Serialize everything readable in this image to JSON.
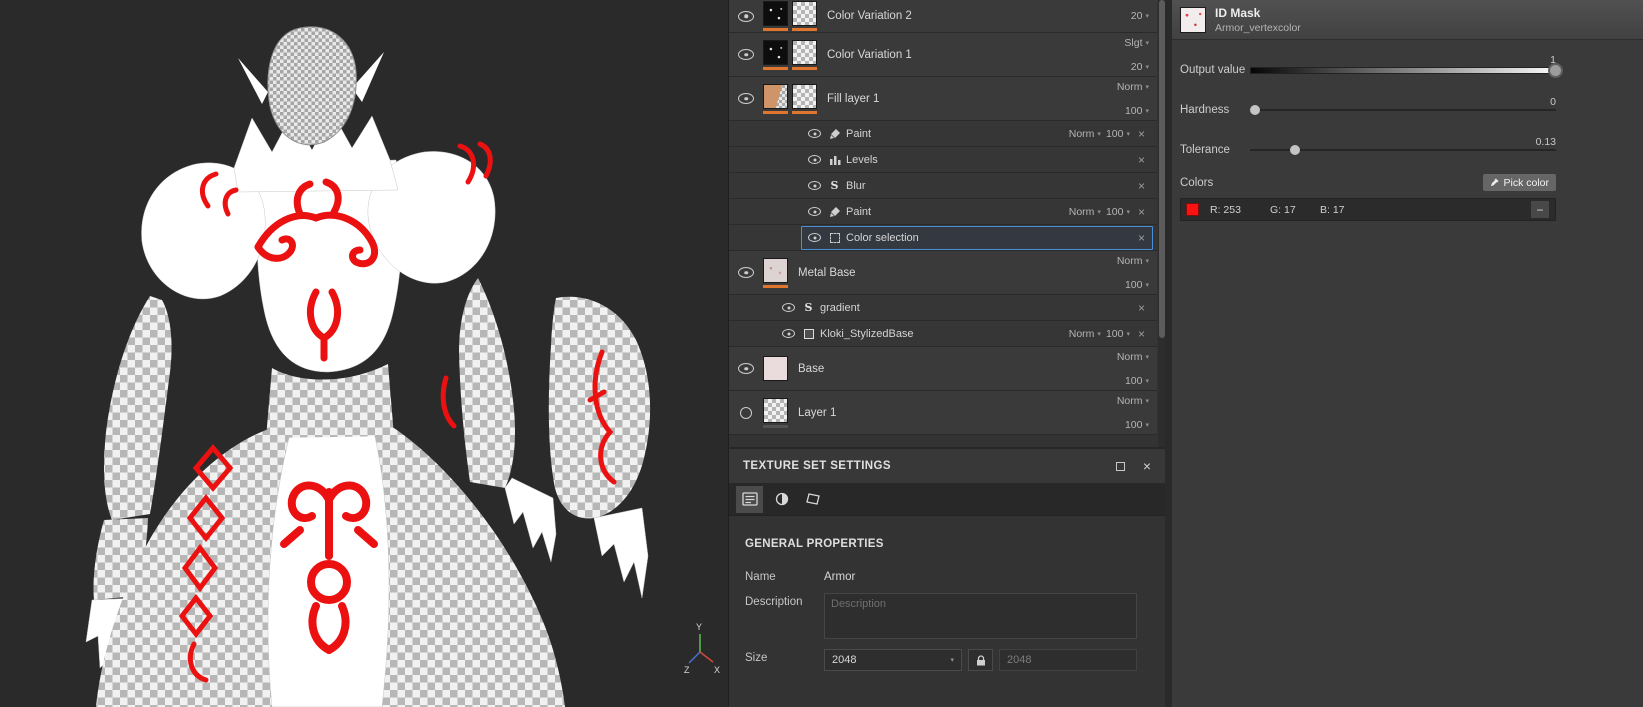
{
  "glyphs": {
    "close": "×",
    "minus": "−"
  },
  "theme": {
    "accent_orange": "#e0762e",
    "selection_blue": "#4a90d9",
    "swatch_red": "#fd1111"
  },
  "viewport": {
    "axis_labels": {
      "x": "X",
      "y": "Y",
      "z": "Z"
    }
  },
  "layers": {
    "rows": [
      {
        "name": "Color Variation 2",
        "opacity": "20"
      },
      {
        "name": "Color Variation 1",
        "blend": "Slgt",
        "opacity": "20"
      },
      {
        "name": "Fill layer 1",
        "blend": "Norm",
        "opacity": "100"
      },
      {
        "name": "Paint",
        "blend": "Norm",
        "opacity": "100"
      },
      {
        "name": "Levels"
      },
      {
        "name": "Blur"
      },
      {
        "name": "Paint",
        "blend": "Norm",
        "opacity": "100"
      },
      {
        "name": "Color selection"
      },
      {
        "name": "Metal Base",
        "blend": "Norm",
        "opacity": "100"
      },
      {
        "name": "gradient"
      },
      {
        "name": "Kloki_StylizedBase",
        "blend": "Norm",
        "opacity": "100"
      },
      {
        "name": "Base",
        "blend": "Norm",
        "opacity": "100"
      },
      {
        "name": "Layer 1",
        "blend": "Norm",
        "opacity": "100"
      }
    ]
  },
  "texture_set_settings": {
    "title": "TEXTURE SET SETTINGS",
    "section_title": "GENERAL PROPERTIES",
    "name_label": "Name",
    "name_value": "Armor",
    "description_label": "Description",
    "description_placeholder": "Description",
    "size_label": "Size",
    "size_value": "2048",
    "size_linked_value": "2048"
  },
  "properties": {
    "title": "ID Mask",
    "subtitle": "Armor_vertexcolor",
    "output_value_label": "Output value",
    "output_value": "1",
    "hardness_label": "Hardness",
    "hardness_value": "0",
    "tolerance_label": "Tolerance",
    "tolerance_value": "0.13",
    "colors_label": "Colors",
    "pick_color_label": "Pick color",
    "color": {
      "r": "R: 253",
      "g": "G: 17",
      "b": "B: 17",
      "hex": "#fd1111"
    }
  }
}
